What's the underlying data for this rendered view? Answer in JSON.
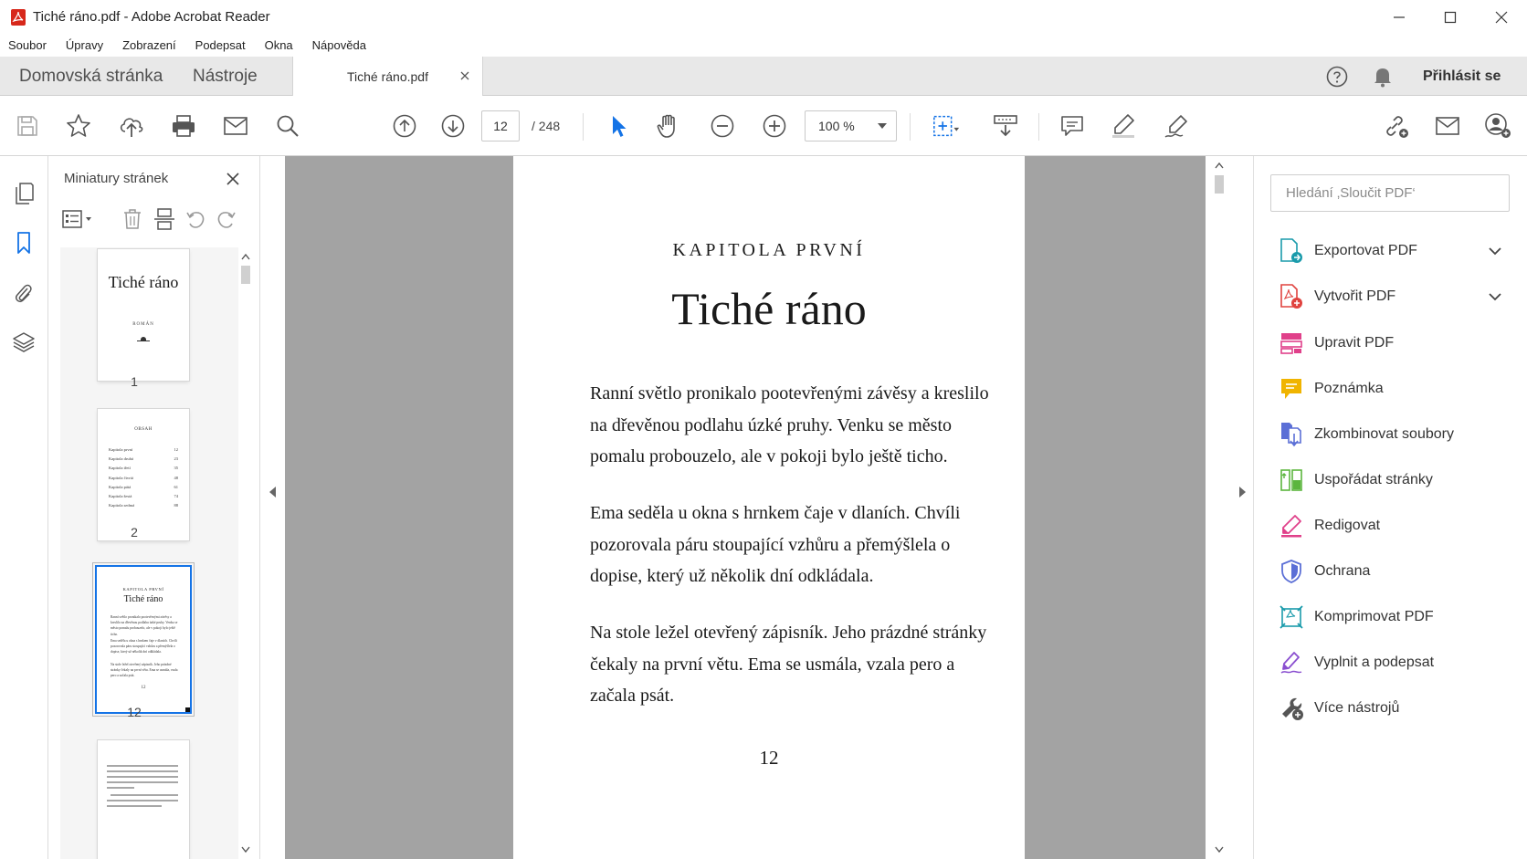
{
  "window": {
    "title": "Tiché ráno.pdf - Adobe Acrobat Reader"
  },
  "menu": [
    "Soubor",
    "Úpravy",
    "Zobrazení",
    "Podepsat",
    "Okna",
    "Nápověda"
  ],
  "tabs": {
    "home": "Domovská stránka",
    "tools": "Nástroje",
    "document": "Tiché ráno.pdf",
    "sign_in": "Přihlásit se"
  },
  "toolbar": {
    "current_page": "12",
    "total_pages": "/ 248",
    "zoom": "100 %"
  },
  "thumbnails": {
    "title": "Miniatury stránek",
    "pages": [
      {
        "number": "1",
        "title": "Tiché ráno",
        "subtitle": "ROMÁN"
      },
      {
        "number": "2",
        "heading": "OBSAH",
        "toc": [
          {
            "chapter": "Kapitola první",
            "page": "12"
          },
          {
            "chapter": "Kapitola druhá",
            "page": "23"
          },
          {
            "chapter": "Kapitola třetí",
            "page": "35"
          },
          {
            "chapter": "Kapitola čtvrtá",
            "page": "48"
          },
          {
            "chapter": "Kapitola pátá",
            "page": "61"
          },
          {
            "chapter": "Kapitola šestá",
            "page": "74"
          },
          {
            "chapter": "Kapitola sedmá",
            "page": "88"
          }
        ]
      },
      {
        "number": "12"
      }
    ]
  },
  "document": {
    "chapter_label": "KAPITOLA PRVNÍ",
    "chapter_title": "Tiché ráno",
    "paragraphs": [
      "Ranní světlo pronikalo pootevřenými závěsy a kreslilo na dřevěnou podlahu úzké pruhy. Venku se město pomalu probouzelo, ale v pokoji bylo ještě ticho.",
      "Ema seděla u okna s hrnkem čaje v dlaních. Chvíli pozorovala páru stoupající vzhůru a přemýšlela o dopise, který už několik dní odkládala.",
      "Na stole ležel otevřený zápisník. Jeho prázdné stránky čekaly na první větu. Ema se usmála, vzala pero a začala psát."
    ],
    "page_number": "12"
  },
  "tools_pane": {
    "search_placeholder": "Hledání ‚Sloučit PDF‘",
    "items": [
      {
        "label": "Exportovat PDF",
        "icon": "export-pdf-icon",
        "color": "#1a9bab",
        "expandable": true
      },
      {
        "label": "Vytvořit PDF",
        "icon": "create-pdf-icon",
        "color": "#e0433f",
        "expandable": true
      },
      {
        "label": "Upravit PDF",
        "icon": "edit-pdf-icon",
        "color": "#e0408a",
        "expandable": false
      },
      {
        "label": "Poznámka",
        "icon": "comment-icon",
        "color": "#f0b400",
        "expandable": false
      },
      {
        "label": "Zkombinovat soubory",
        "icon": "combine-files-icon",
        "color": "#5b6fd6",
        "expandable": false
      },
      {
        "label": "Uspořádat stránky",
        "icon": "organize-pages-icon",
        "color": "#5bb53d",
        "expandable": false
      },
      {
        "label": "Redigovat",
        "icon": "redact-icon",
        "color": "#e0408a",
        "expandable": false
      },
      {
        "label": "Ochrana",
        "icon": "protect-icon",
        "color": "#5b6fd6",
        "expandable": false
      },
      {
        "label": "Komprimovat PDF",
        "icon": "compress-pdf-icon",
        "color": "#1a9bab",
        "expandable": false
      },
      {
        "label": "Vyplnit a podepsat",
        "icon": "fill-sign-icon",
        "color": "#8a4fd0",
        "expandable": false
      },
      {
        "label": "Více nástrojů",
        "icon": "more-tools-icon",
        "color": "#555555",
        "expandable": false
      }
    ]
  },
  "colors": {
    "accent_blue": "#1473e6",
    "acrobat_red": "#d7281b"
  }
}
